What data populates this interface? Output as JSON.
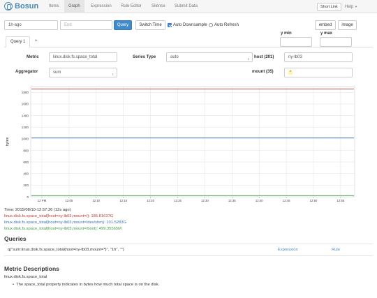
{
  "nav": {
    "brand": "Bosun",
    "items": [
      "Items",
      "Graph",
      "Expression",
      "Rule Editor",
      "Silence",
      "Submit Data"
    ],
    "active": "Graph",
    "short_link": "Short Link",
    "help": "Help"
  },
  "controls": {
    "start_value": "1h-ago",
    "end_placeholder": "End",
    "query_button": "Query",
    "switch_time_button": "Switch Time",
    "auto_downsample_label": "Auto Downsample",
    "auto_downsample_checked": true,
    "auto_refresh_label": "Auto Refresh",
    "ymin_label": "y min",
    "ymax_label": "y max",
    "embed_button": "embed",
    "image_button": "image"
  },
  "tabs": [
    "Query 1",
    "+"
  ],
  "query": {
    "metric_label": "Metric",
    "metric_value": "linux.disk.fs.space_total",
    "series_type_label": "Series Type",
    "series_type_value": "auto",
    "host_label": "host (201)",
    "host_value": "ny-lb03",
    "aggregator_label": "Aggregator",
    "aggregator_value": "sum",
    "mount_label": "mount (35)",
    "mount_value": "*"
  },
  "chart_data": {
    "type": "line",
    "ylabel": "bytes",
    "ylim": [
      0,
      1900
    ],
    "yticks": [
      0,
      200,
      400,
      600,
      800,
      1000,
      1200,
      1400,
      1600,
      1800
    ],
    "xticks": [
      "12 PM",
      "12:05",
      "12:10",
      "12:15",
      "12:20",
      "12:25",
      "12:30",
      "12:35",
      "12:40",
      "12:45",
      "12:50",
      "12:55"
    ],
    "grid": true,
    "series": [
      {
        "name": "linux.disk.fs.space_total{host=ny-lb03,mount=/}",
        "color": "#c0504d",
        "values": [
          1857,
          1857
        ]
      },
      {
        "name": "linux.disk.fs.space_total{host=ny-lb03,mount=/dev/shm}",
        "color": "#4f81bd",
        "values": [
          1015,
          1015
        ]
      },
      {
        "name": "linux.disk.fs.space_total{host=ny-lb03,mount=/boot}",
        "color": "#4fa84f",
        "values": [
          20,
          20
        ]
      }
    ]
  },
  "legend": {
    "time": "Time: 2015/08/10-12:57:26 (12s ago)",
    "entries": [
      {
        "text": "linux.disk.fs.space_total{host=ny-lb03,mount=/}: 185.81637G",
        "color": "#c0392b"
      },
      {
        "text": "linux.disk.fs.space_total{host=ny-lb03,mount=/dev/shm}: 101.5283G",
        "color": "#3a6fb0"
      },
      {
        "text": "linux.disk.fs.space_total{host=ny-lb03,mount=/boot}: 499.35565M",
        "color": "#3f9b3f"
      }
    ]
  },
  "queries": {
    "heading": "Queries",
    "text": "q(\"sum:linux.disk.fs.space_total{host=ny-lb03,mount=*}\", \"1h\", \"\")",
    "expression_link": "Expression",
    "rule_link": "Rule"
  },
  "metric_descriptions": {
    "heading": "Metric Descriptions",
    "metric": "linux.disk.fs.space_total",
    "bullet": "The space_total property indicates in bytes how much total space is on the disk."
  }
}
